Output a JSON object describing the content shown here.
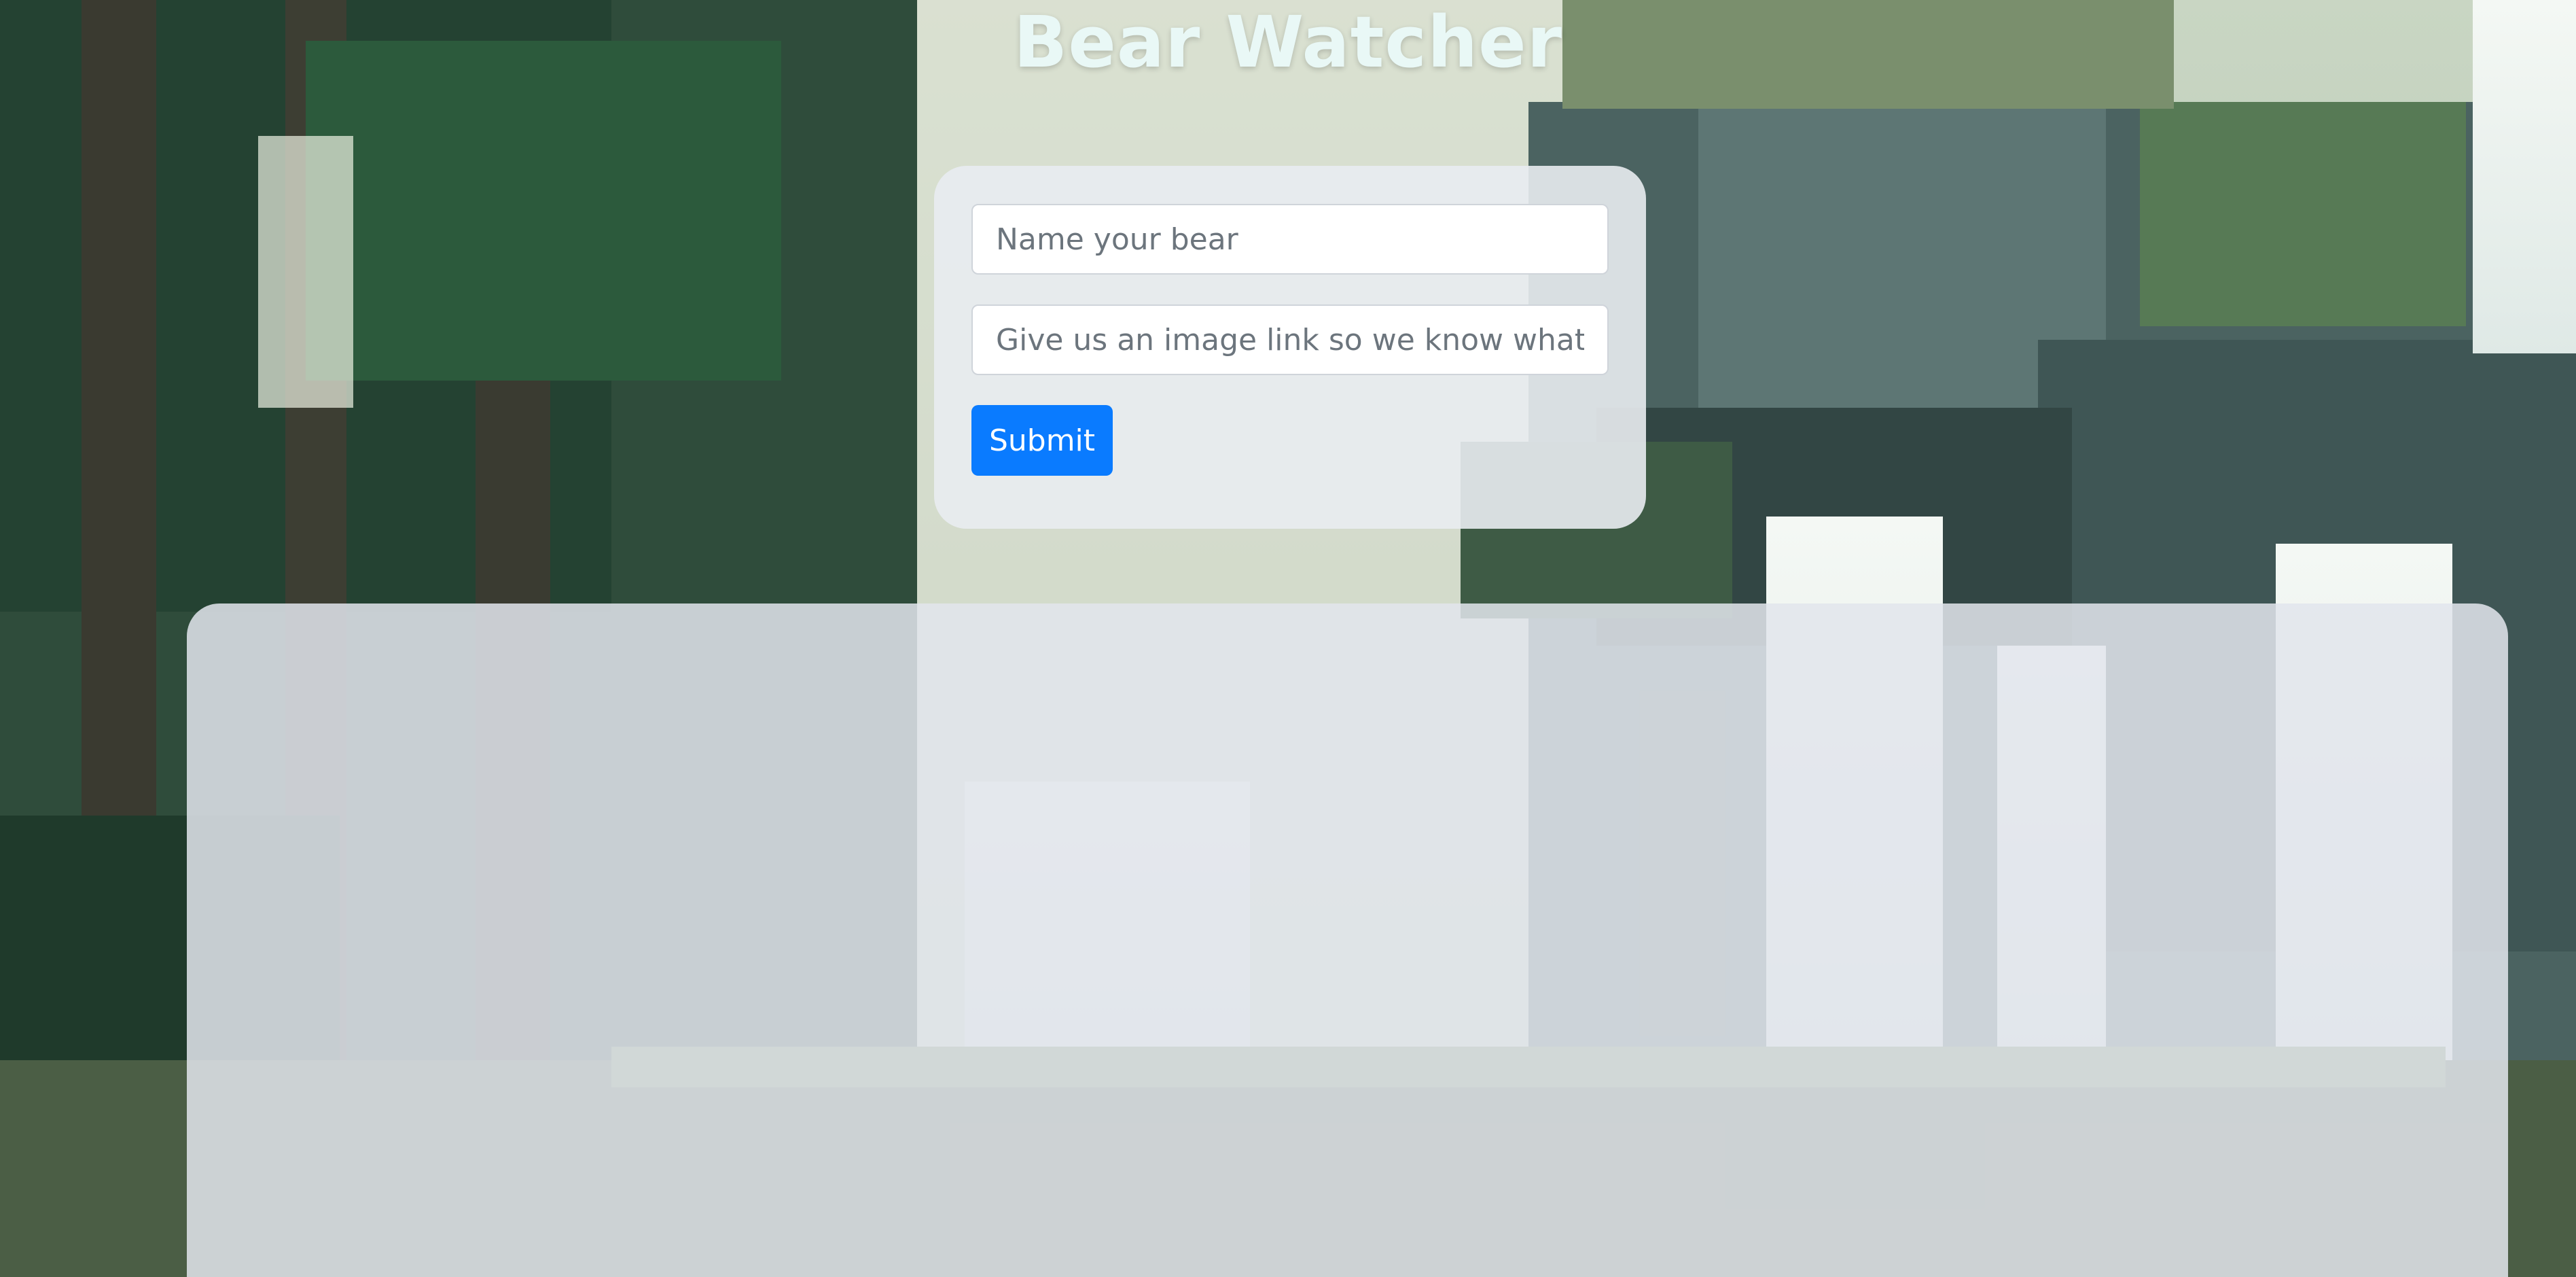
{
  "header": {
    "title": "Bear Watcher"
  },
  "form": {
    "name_placeholder": "Name your bear",
    "image_placeholder": "Give us an image link so we know what it looks like",
    "submit_label": "Submit"
  },
  "bear_list": {
    "items": []
  },
  "colors": {
    "title": "#e9f8f6",
    "submit_button": "#0a7bff",
    "card_background": "#e9ecf1",
    "panel_background": "#e2e5ec"
  }
}
